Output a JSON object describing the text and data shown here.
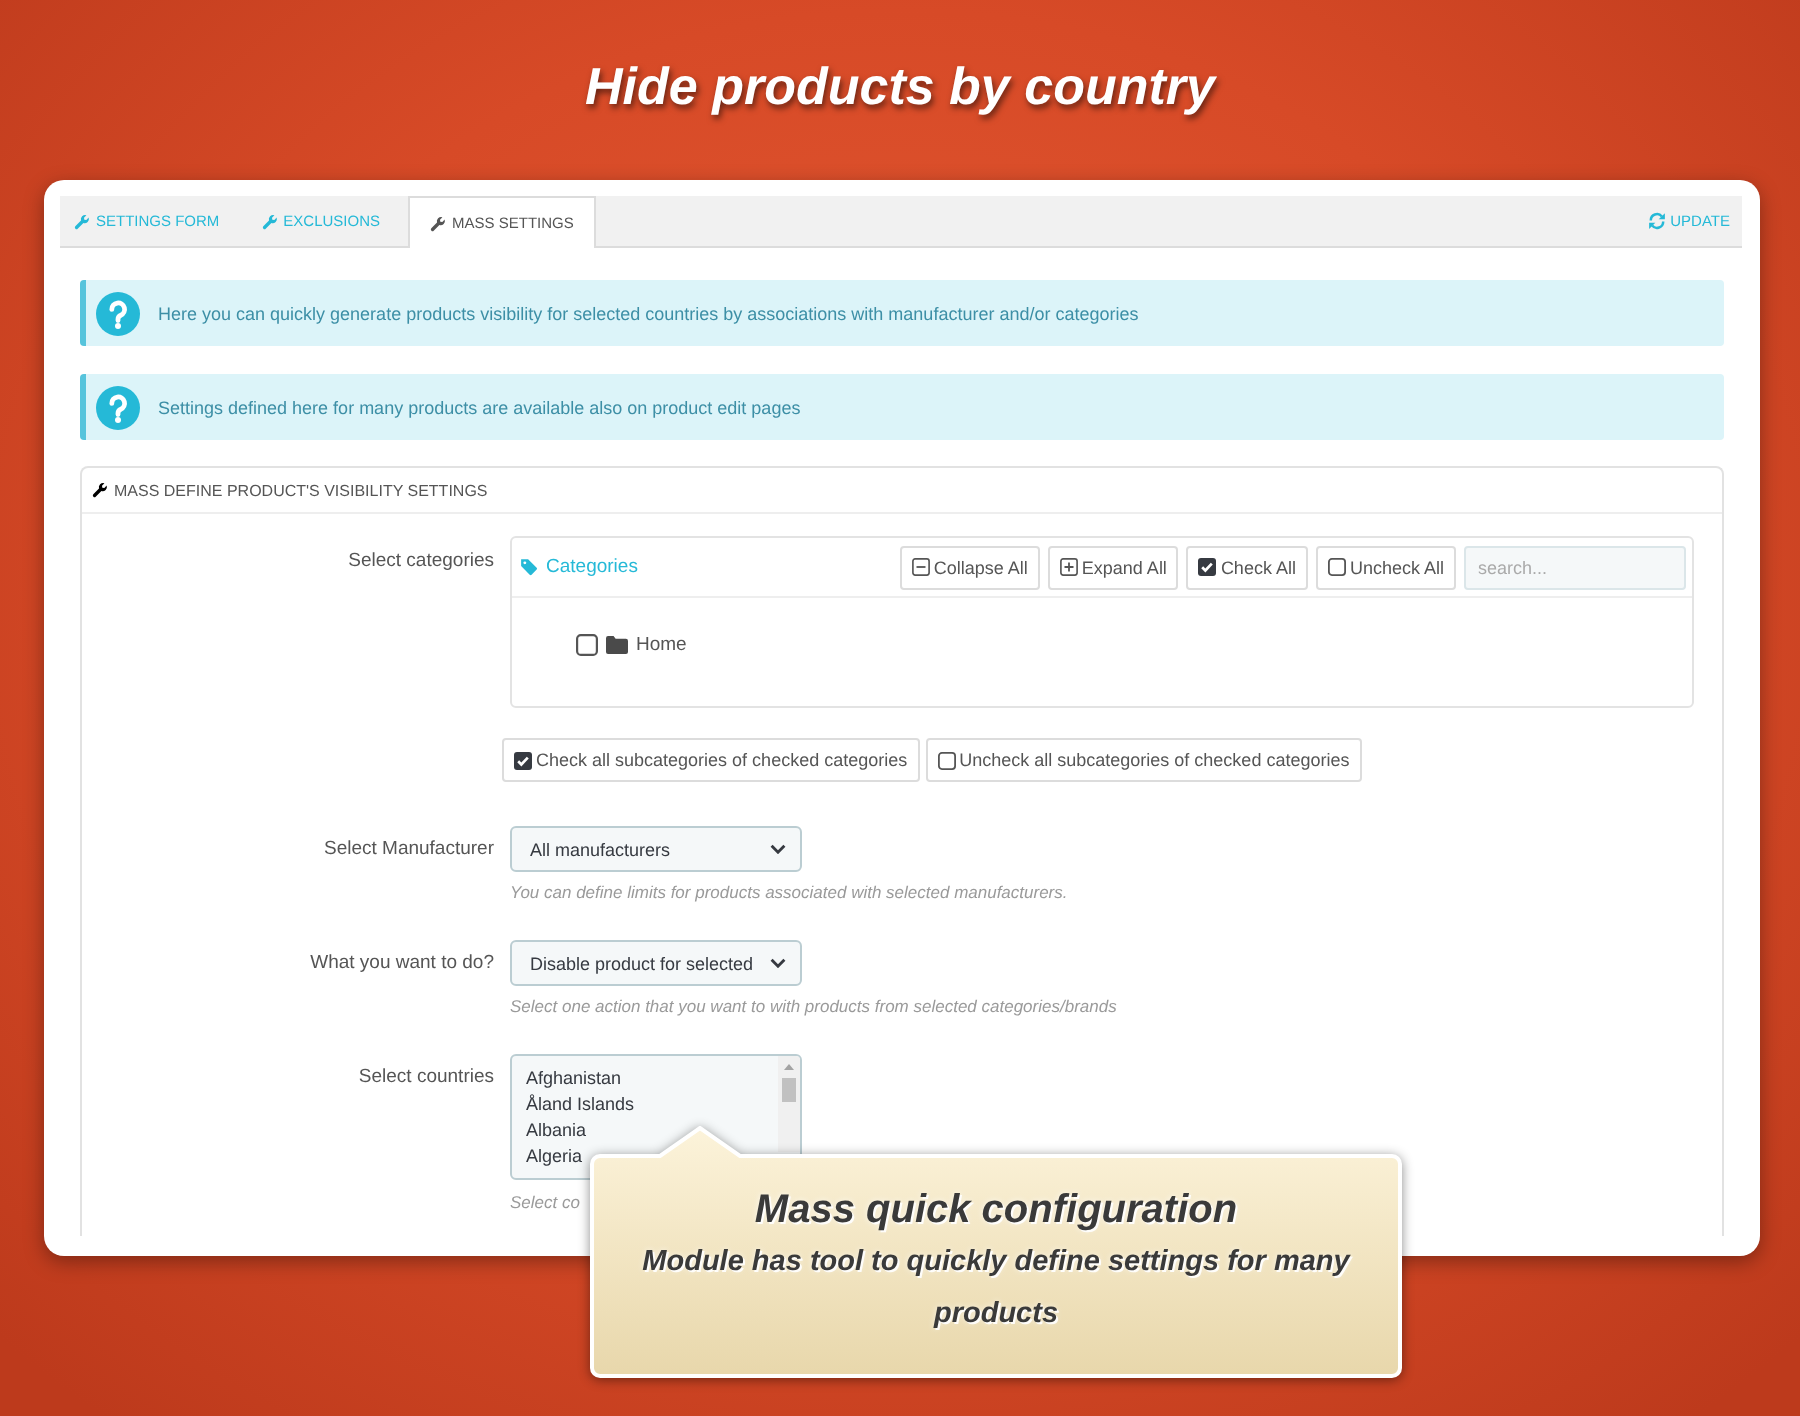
{
  "heading": "Hide products by country",
  "tabs": [
    {
      "label": "SETTINGS FORM",
      "selected": false
    },
    {
      "label": "EXCLUSIONS",
      "selected": false
    },
    {
      "label": "MASS SETTINGS",
      "selected": true
    }
  ],
  "update_button": "UPDATE",
  "alerts": [
    "Here you can quickly generate products visibility for selected countries by associations with manufacturer and/or categories",
    "Settings defined here for many products are available also on product edit pages"
  ],
  "panel": {
    "title": "MASS DEFINE PRODUCT'S VISIBILITY SETTINGS",
    "categories": {
      "label": "Select categories",
      "tree_title": "Categories",
      "buttons": [
        {
          "label": "Collapse All",
          "kind": "collapse"
        },
        {
          "label": "Expand All",
          "kind": "expand"
        },
        {
          "label": "Check All",
          "kind": "check"
        },
        {
          "label": "Uncheck All",
          "kind": "uncheck"
        }
      ],
      "search": {
        "placeholder": "search..."
      },
      "tree": [
        {
          "label": "Home",
          "checked": false
        }
      ]
    },
    "subcategory_buttons": [
      {
        "label": "Check all subcategories of checked categories",
        "checked": true
      },
      {
        "label": "Uncheck all subcategories of checked categories",
        "checked": false
      }
    ],
    "manufacturer": {
      "label": "Select Manufacturer",
      "value": "All manufacturers",
      "help": "You can define limits for products associated with selected manufacturers."
    },
    "action": {
      "label": "What you want to do?",
      "value": "Disable product for selected",
      "help": "Select one action that you want to with products from selected categories/brands"
    },
    "countries": {
      "label": "Select countries",
      "options": [
        "Afghanistan",
        "Åland Islands",
        "Albania",
        "Algeria"
      ],
      "help": "Select co"
    }
  },
  "callout": {
    "title": "Mass quick configuration",
    "text": "Module has tool to quickly define settings for many products"
  }
}
